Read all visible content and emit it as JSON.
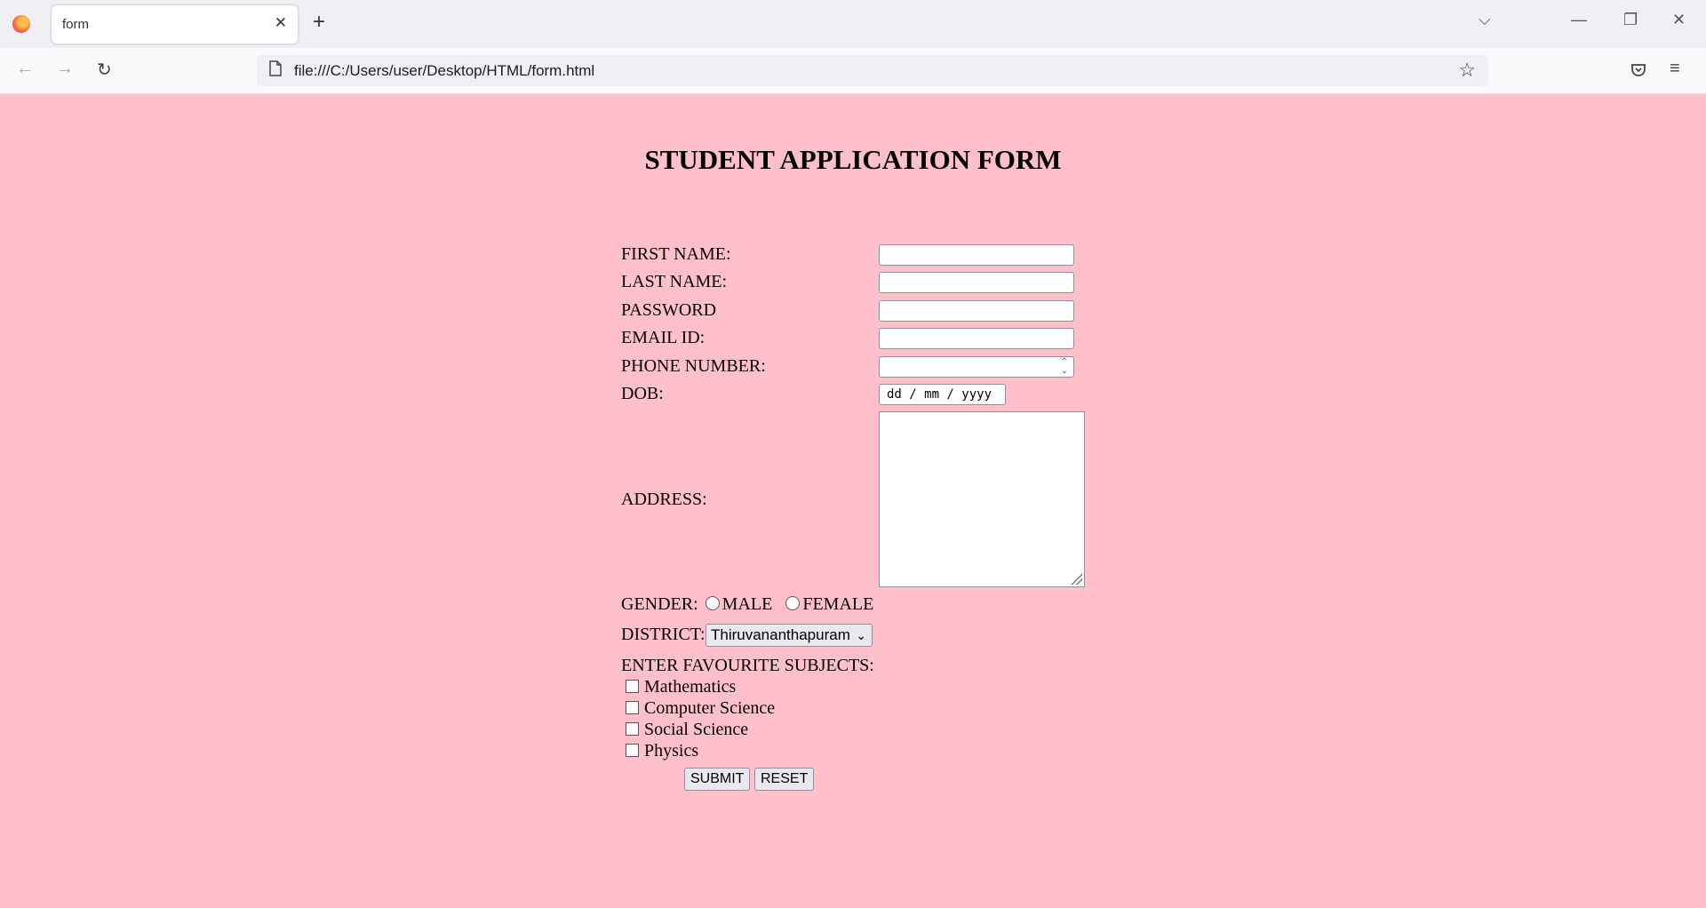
{
  "browser": {
    "tab_title": "form",
    "url": "file:///C:/Users/user/Desktop/HTML/form.html"
  },
  "form": {
    "heading": "STUDENT APPLICATION FORM",
    "labels": {
      "first_name": "FIRST NAME:",
      "last_name": "LAST NAME:",
      "password": "PASSWORD",
      "email": "EMAIL ID:",
      "phone": "PHONE NUMBER:",
      "dob": "DOB:",
      "address": "ADDRESS:",
      "gender": "GENDER:",
      "district": "DISTRICT:",
      "subjects": "ENTER FAVOURITE SUBJECTS:"
    },
    "dob_placeholder": "dd / mm / yyyy",
    "gender_options": [
      "MALE",
      "FEMALE"
    ],
    "district_selected": "Thiruvananthapuram",
    "subjects": [
      "Mathematics",
      "Computer Science",
      "Social Science",
      "Physics"
    ],
    "submit_label": "SUBMIT",
    "reset_label": "RESET"
  },
  "colors": {
    "page_background": "pink"
  }
}
